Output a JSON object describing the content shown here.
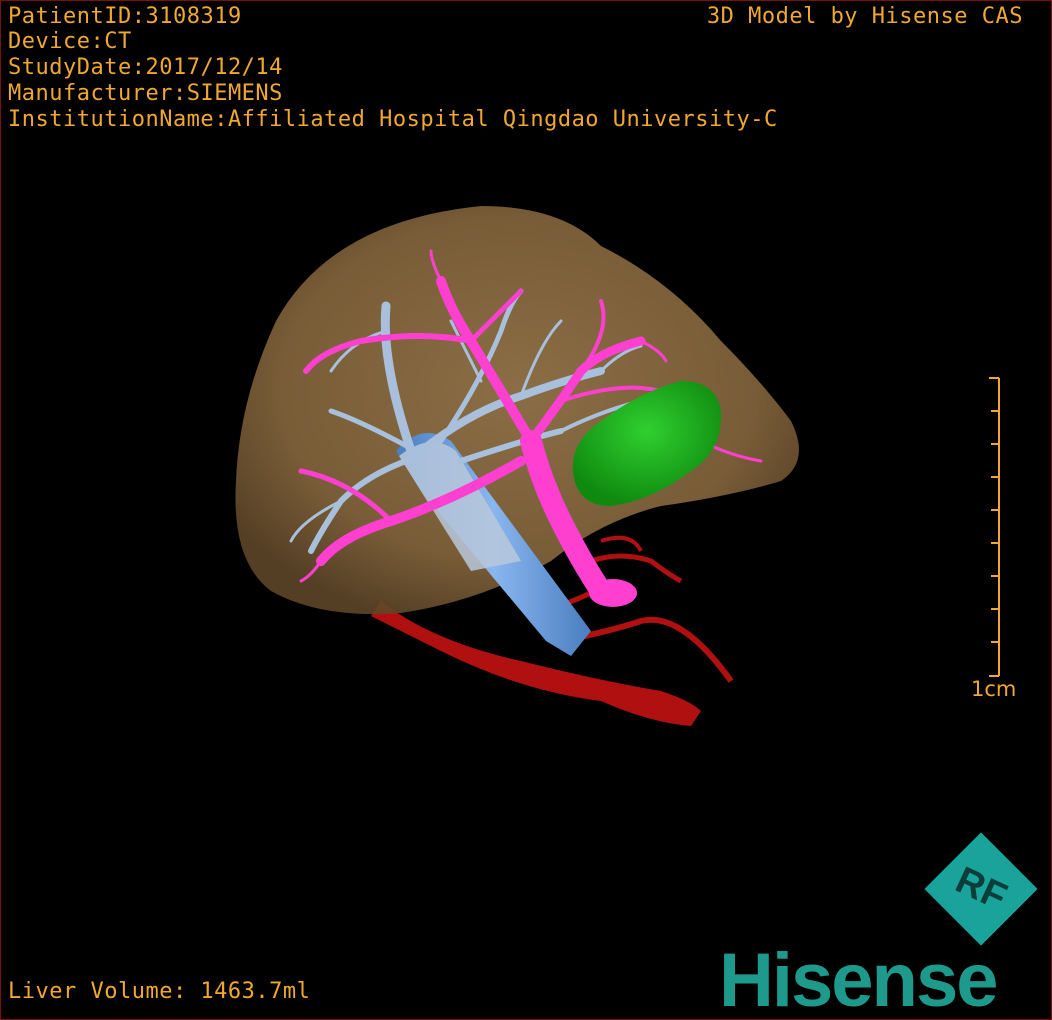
{
  "overlay": {
    "patient_id": {
      "label": "PatientID",
      "value": "3108319"
    },
    "device": {
      "label": "Device",
      "value": "CT"
    },
    "study_date": {
      "label": "StudyDate",
      "value": "2017/12/14"
    },
    "manufacturer": {
      "label": "Manufacturer",
      "value": "SIEMENS"
    },
    "institution": {
      "label": "InstitutionName",
      "value": "Affiliated Hospital Qingdao University-C"
    },
    "credit": "3D Model by Hisense CAS",
    "liver_volume": "Liver Volume: 1463.7ml",
    "scale_label": "1cm"
  },
  "brand": {
    "logo_text": "RF",
    "name": "Hisense"
  },
  "colors": {
    "overlay_text": "#f0a830",
    "liver": "#8a6a3f",
    "portal_vein": "#ff3fd0",
    "hepatic_vein": "#a8c0dc",
    "ivc": "#6a9ede",
    "artery": "#b01010",
    "tumor": "#1cb01c",
    "brand": "#1e9a8c"
  }
}
